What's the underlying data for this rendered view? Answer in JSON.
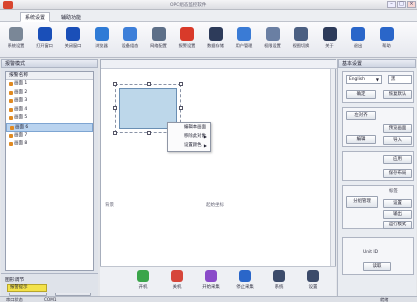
{
  "window": {
    "title": "OPC组态监控软件",
    "min": "–",
    "max": "□",
    "close": "×"
  },
  "menu_tabs": [
    {
      "label": "系统设置",
      "active": true
    },
    {
      "label": "辅助功能",
      "active": false
    }
  ],
  "toolbar": [
    {
      "label": "系统设置",
      "icon": "settings-icon",
      "color": "#7a8797"
    },
    {
      "label": "打开窗口",
      "icon": "play-icon",
      "color": "#1a4fb8"
    },
    {
      "label": "关闭窗口",
      "icon": "stop-icon",
      "color": "#1a4fb8"
    },
    {
      "label": "浏览器",
      "icon": "browser-icon",
      "color": "#2f7bd6"
    },
    {
      "label": "设备组态",
      "icon": "device-icon",
      "color": "#3d7fd9"
    },
    {
      "label": "网络配置",
      "icon": "grid-icon",
      "color": "#5d6f88"
    },
    {
      "label": "报警设置",
      "icon": "alarm-icon",
      "color": "#d93a2a"
    },
    {
      "label": "数据存储",
      "icon": "database-icon",
      "color": "#2d3b5a"
    },
    {
      "label": "用户管理",
      "icon": "users-icon",
      "color": "#3a7bd5"
    },
    {
      "label": "权限设置",
      "icon": "key-icon",
      "color": "#6a7fa3"
    },
    {
      "label": "视图切换",
      "icon": "view-icon",
      "color": "#4b5f82"
    },
    {
      "label": "关于",
      "icon": "about-icon",
      "color": "#2d3b5a"
    },
    {
      "label": "退出",
      "icon": "exit-icon",
      "color": "#2a66c9"
    },
    {
      "label": "帮助",
      "icon": "help-icon",
      "color": "#2a66c9"
    }
  ],
  "left_panel": {
    "title": "报警模式",
    "tree_header": "报警名称",
    "items": [
      "画面 1",
      "画面 2",
      "画面 3",
      "画面 4",
      "画面 5",
      "画面 6",
      "画面 7",
      "画面 8"
    ],
    "selected_index": 5,
    "rename_button": "重命名",
    "save_button": "保存"
  },
  "canvas": {
    "label_left": "背景",
    "label_mid": "起始坐标",
    "context_menu": [
      "编辑本画面",
      "移除此对象",
      "设置颜色"
    ]
  },
  "right_panel": {
    "title": "基本设置",
    "font_select": "English",
    "size_value": "黑",
    "btn_left_1": "确定",
    "btn_right_1": "恢复默认",
    "btn_text_pos": "左对齐",
    "btn_edit": "编辑",
    "btn_preview": "预览画面",
    "btn_import": "导入",
    "btn_apply": "应用",
    "btn_save": "保存布局",
    "btn_layout": "分组管理",
    "btn_label": "标签",
    "btn_setting": "设置",
    "btn_output": "输出",
    "btn_run": "运行模式",
    "unit_label": "Unit ID",
    "read_label": "读取"
  },
  "bottom_strip": [
    {
      "label": "开机",
      "icon": "power-icon",
      "color": "#3aa54a"
    },
    {
      "label": "关机",
      "icon": "shutdown-icon",
      "color": "#d6463a"
    },
    {
      "label": "开始采集",
      "icon": "start-icon",
      "color": "#8a4bc9"
    },
    {
      "label": "停止采集",
      "icon": "pause-icon",
      "color": "#2a66c9"
    },
    {
      "label": "系统",
      "icon": "system-icon",
      "color": "#3c4b6a"
    },
    {
      "label": "设置",
      "icon": "config-icon",
      "color": "#3c4b6a"
    }
  ],
  "left_dock": {
    "title": "图形调节",
    "badge": "报警提示"
  },
  "status": {
    "left": "串口状态",
    "mid": "COM1",
    "right": "就绪"
  }
}
